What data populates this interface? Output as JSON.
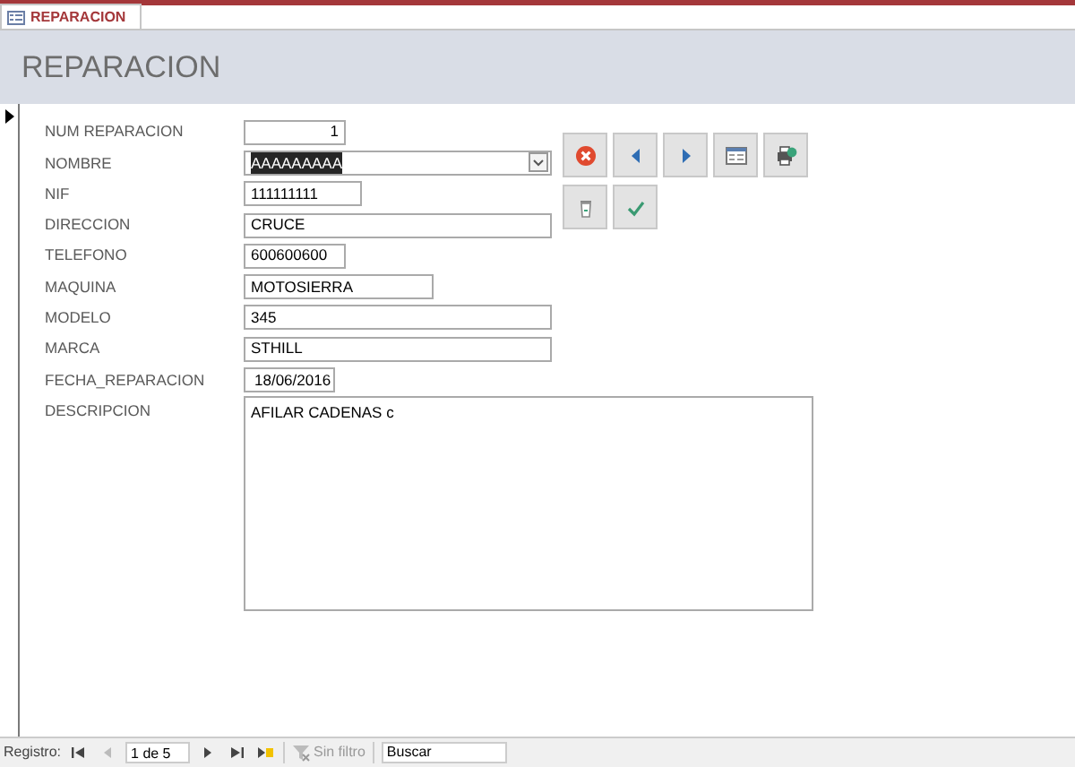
{
  "tab": {
    "label": "REPARACION",
    "selected": true
  },
  "header": {
    "title": "REPARACION"
  },
  "fields": [
    {
      "label": "NUM REPARACION",
      "kind": "number",
      "value": "1",
      "text_selected": false
    },
    {
      "label": "NOMBRE",
      "kind": "combo",
      "value": "AAAAAAAAA",
      "text_selected": true
    },
    {
      "label": "NIF",
      "kind": "text",
      "value": "111111111",
      "text_selected": false
    },
    {
      "label": "DIRECCION",
      "kind": "text",
      "value": "CRUCE",
      "text_selected": false
    },
    {
      "label": "TELEFONO",
      "kind": "text",
      "value": "600600600",
      "text_selected": false
    },
    {
      "label": "MAQUINA",
      "kind": "text",
      "value": "MOTOSIERRA",
      "text_selected": false
    },
    {
      "label": "MODELO",
      "kind": "text",
      "value": "345",
      "text_selected": false
    },
    {
      "label": "MARCA",
      "kind": "text",
      "value": "STHILL",
      "text_selected": false
    },
    {
      "label": "FECHA_REPARACION",
      "kind": "date",
      "value": "18/06/2016",
      "text_selected": false
    },
    {
      "label": "DESCRIPCION",
      "kind": "memo",
      "value": "AFILAR CADENAS c",
      "text_selected": false
    }
  ],
  "buttons": [
    [
      {
        "kind": "delete"
      },
      {
        "kind": "previous"
      },
      {
        "kind": "next"
      },
      {
        "kind": "form"
      },
      {
        "kind": "print"
      }
    ],
    [
      {
        "kind": "trash"
      },
      {
        "kind": "save"
      }
    ]
  ],
  "status_bar": {
    "label": "Registro:",
    "position": "1 de 5",
    "filter": "Sin filtro",
    "search_placeholder": "Buscar",
    "nav_buttons": [
      {
        "kind": "first",
        "disabled": false
      },
      {
        "kind": "prev",
        "disabled": true
      },
      {
        "kind": "next",
        "disabled": false
      },
      {
        "kind": "last",
        "disabled": false
      },
      {
        "kind": "new",
        "disabled": false
      }
    ]
  }
}
